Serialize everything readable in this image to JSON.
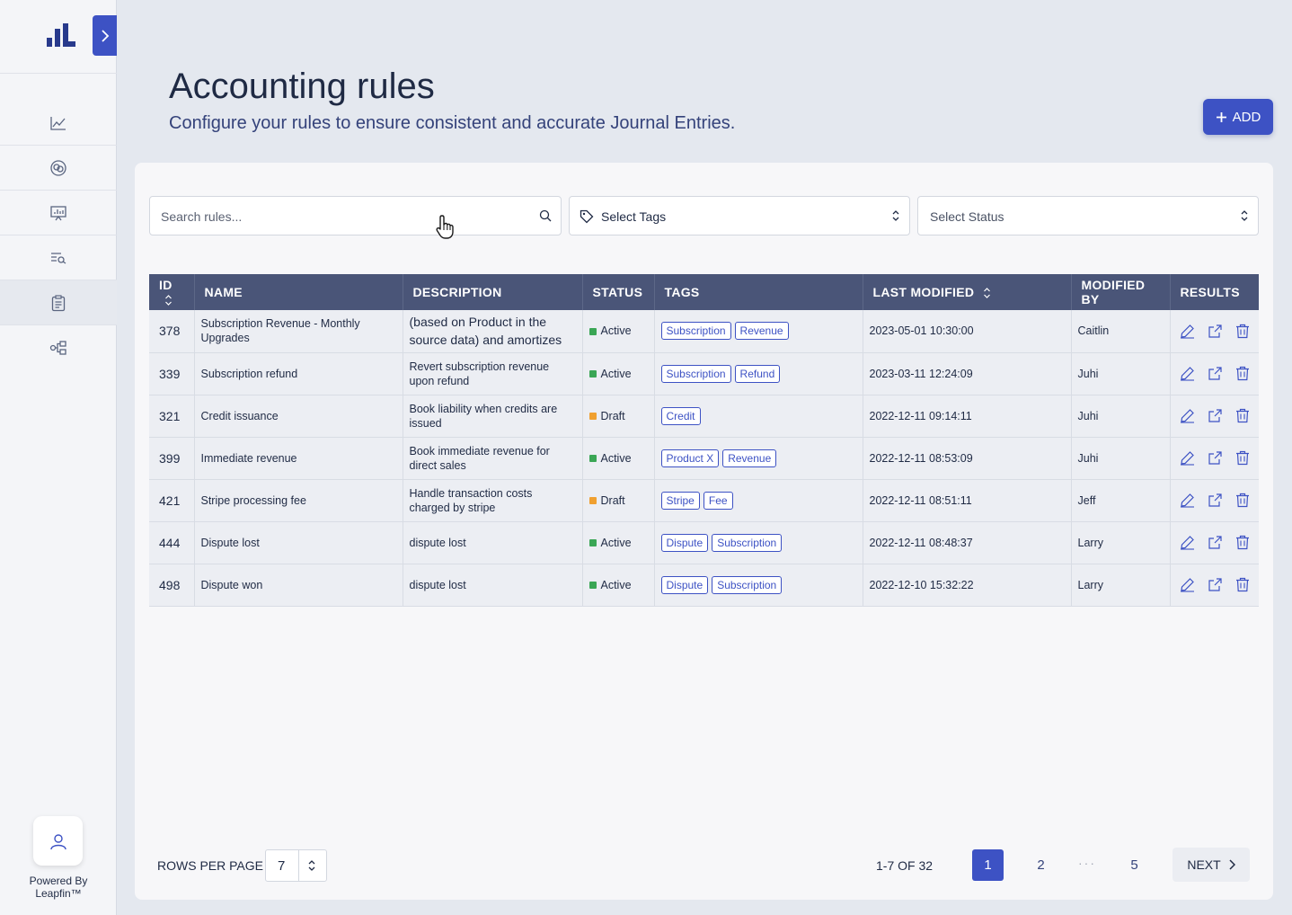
{
  "sidebar": {
    "brand": "Leapfin",
    "powered_by_line1": "Powered By",
    "powered_by_line2": "Leapfin™",
    "nav_icons": [
      "chart-line-icon",
      "link-circles-icon",
      "presentation-icon",
      "search-list-icon",
      "clipboard-icon",
      "share-nodes-icon"
    ],
    "active_index": 4
  },
  "header": {
    "title": "Accounting rules",
    "subtitle": "Configure your rules to ensure consistent and accurate Journal Entries.",
    "add_label": "ADD"
  },
  "filters": {
    "search_placeholder": "Search rules...",
    "tags_label": "Select Tags",
    "status_label": "Select Status"
  },
  "table": {
    "columns": [
      "ID",
      "NAME",
      "DESCRIPTION",
      "STATUS",
      "TAGS",
      "LAST MODIFIED",
      "MODIFIED BY",
      "RESULTS"
    ],
    "rows": [
      {
        "id": "378",
        "name": "Subscription Revenue - Monthly Upgrades",
        "description": "(based on Product in the source data) and amortizes",
        "status": "Active",
        "tags": [
          "Subscription",
          "Revenue"
        ],
        "last_modified": "2023-05-01 10:30:00",
        "modified_by": "Caitlin"
      },
      {
        "id": "339",
        "name": "Subscription refund",
        "description": "Revert subscription revenue upon refund",
        "status": "Active",
        "tags": [
          "Subscription",
          "Refund"
        ],
        "last_modified": "2023-03-11 12:24:09",
        "modified_by": "Juhi"
      },
      {
        "id": "321",
        "name": "Credit issuance",
        "description": "Book liability when credits are issued",
        "status": "Draft",
        "tags": [
          "Credit"
        ],
        "last_modified": "2022-12-11 09:14:11",
        "modified_by": "Juhi"
      },
      {
        "id": "399",
        "name": "Immediate revenue",
        "description": "Book immediate revenue for direct sales",
        "status": "Active",
        "tags": [
          "Product X",
          "Revenue"
        ],
        "last_modified": "2022-12-11 08:53:09",
        "modified_by": "Juhi"
      },
      {
        "id": "421",
        "name": "Stripe processing fee",
        "description": "Handle transaction costs charged by stripe",
        "status": "Draft",
        "tags": [
          "Stripe",
          "Fee"
        ],
        "last_modified": "2022-12-11 08:51:11",
        "modified_by": "Jeff"
      },
      {
        "id": "444",
        "name": "Dispute lost",
        "description": "dispute lost",
        "status": "Active",
        "tags": [
          "Dispute",
          "Subscription"
        ],
        "last_modified": "2022-12-11 08:48:37",
        "modified_by": "Larry"
      },
      {
        "id": "498",
        "name": "Dispute won",
        "description": "dispute lost",
        "status": "Active",
        "tags": [
          "Dispute",
          "Subscription"
        ],
        "last_modified": "2022-12-10 15:32:22",
        "modified_by": "Larry"
      }
    ]
  },
  "pagination": {
    "rows_per_page_label": "ROWS PER PAGE",
    "rows_per_page": "7",
    "range": "1-7 OF 32",
    "pages": [
      "1",
      "2",
      "5"
    ],
    "current_page": "1",
    "ellipsis": "···",
    "next_label": "NEXT"
  },
  "colors": {
    "accent": "#3d52c4",
    "header_bg": "#4a5578",
    "active_status": "#3aa655",
    "draft_status": "#f0a030"
  }
}
